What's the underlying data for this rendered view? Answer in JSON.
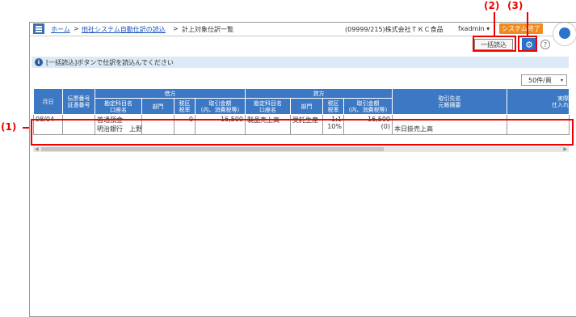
{
  "annotations": {
    "c1": "(1)",
    "c2": "(2)",
    "c3": "(3)"
  },
  "header": {
    "breadcrumb": [
      {
        "label": "ホーム",
        "link": true
      },
      {
        "label": "他社システム自動仕訳の読込",
        "link": true
      },
      {
        "label": "計上対象仕訳一覧",
        "link": false
      }
    ],
    "separator": ">",
    "company": "(09999/215)株式会社ＴＫＣ食品",
    "user": "fxadmin",
    "user_caret": "▾",
    "exit_label": "システム終了"
  },
  "toolbar": {
    "bulk_read_label": "一括読込",
    "gear_glyph": "⚙",
    "help_glyph": "?"
  },
  "info": {
    "icon": "i",
    "message": "[一括読込]ボタンで仕訳を読込んでください"
  },
  "pager": {
    "per_page": "50件/頁",
    "caret": "▾"
  },
  "table": {
    "group_headers": {
      "debit": "借方",
      "credit": "貸方"
    },
    "headers": {
      "date": "月日",
      "voucher_l1": "伝票番号",
      "voucher_l2": "証憑番号",
      "d_account_l1": "勘定科目名",
      "d_account_l2": "口座名",
      "d_dept": "部門",
      "d_tax_l1": "税区",
      "d_tax_l2": "税率",
      "d_amount_l1": "取引金額",
      "d_amount_l2": "(内、消費税等)",
      "c_account_l1": "勘定科目名",
      "c_account_l2": "口座名",
      "c_dept": "部門",
      "c_tax_l1": "税区",
      "c_tax_l2": "税率",
      "c_amount_l1": "取引金額",
      "c_amount_l2": "(内、消費税等)",
      "partner_l1": "取引先名",
      "partner_l2": "元帳摘要",
      "extra_l1": "実際",
      "extra_l2": "仕入れ"
    },
    "rows": [
      {
        "date": "08/04",
        "voucher": "",
        "d_account": "普通預金",
        "d_bank": "明治銀行　上野",
        "d_dept": "",
        "d_tax": "0",
        "d_amount": "16,500",
        "c_account": "製品売上高",
        "c_dept": "受託生産（",
        "c_tax1": "1:1",
        "c_tax2": "10%",
        "c_amount": "16,500",
        "c_tax_amount": "(0)",
        "memo": "本日掛売上高",
        "extra": ""
      }
    ]
  },
  "scroll": {
    "left": "◀",
    "right": "▶"
  }
}
